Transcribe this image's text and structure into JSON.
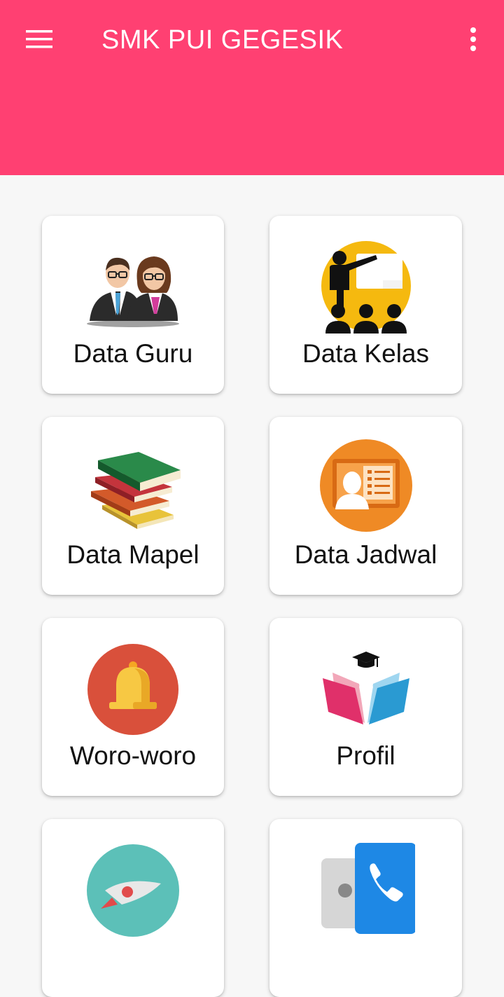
{
  "appbar": {
    "title": "SMK PUI GEGESIK",
    "menu_icon": "hamburger-menu-icon",
    "more_icon": "more-vert-icon",
    "color": "#ff4072"
  },
  "menu": {
    "items": [
      {
        "label": "Data Guru",
        "icon": "teachers-icon"
      },
      {
        "label": "Data Kelas",
        "icon": "classroom-icon"
      },
      {
        "label": "Data Mapel",
        "icon": "books-icon"
      },
      {
        "label": "Data Jadwal",
        "icon": "schedule-icon"
      },
      {
        "label": "Woro-woro",
        "icon": "bell-icon"
      },
      {
        "label": "Profil",
        "icon": "profile-book-icon"
      },
      {
        "label": "",
        "icon": "rocket-icon"
      },
      {
        "label": "",
        "icon": "phone-contact-icon"
      }
    ]
  }
}
